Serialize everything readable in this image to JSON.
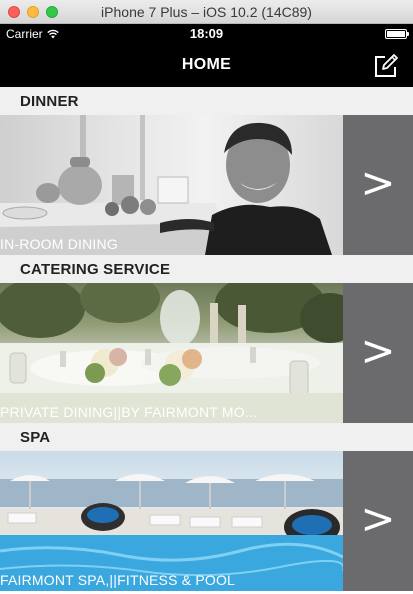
{
  "window": {
    "title": "iPhone 7 Plus – iOS 10.2 (14C89)"
  },
  "status_bar": {
    "carrier": "Carrier",
    "time": "18:09",
    "battery_level": 1.0
  },
  "nav": {
    "title": "HOME",
    "right_icon": "compose-icon"
  },
  "sections": [
    {
      "label": "DINNER",
      "caption": "IN-ROOM DINING",
      "arrow": ">"
    },
    {
      "label": "CATERING SERVICE",
      "caption": "PRIVATE DINING||BY FAIRMONT MO...",
      "arrow": ">"
    },
    {
      "label": "SPA",
      "caption": "FAIRMONT SPA,||FITNESS & POOL",
      "arrow": ">"
    }
  ],
  "colors": {
    "nav_background": "#000000",
    "section_header_background": "#f0f0f0",
    "arrow_panel": "#6b6b6d"
  }
}
